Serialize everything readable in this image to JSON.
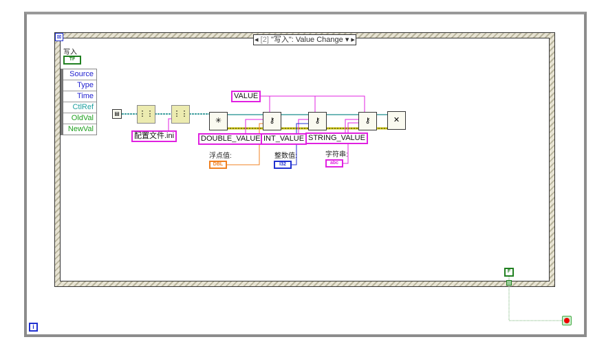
{
  "event_structure": {
    "case_index": "[2]",
    "case_label": "\"写入\": Value Change",
    "dropdown_icon": "triangle-down-icon"
  },
  "control": {
    "label": "写入",
    "terminal": "TF"
  },
  "event_data_node": {
    "items": [
      "Source",
      "Type",
      "Time",
      "CtlRef",
      "OldVal",
      "NewVal"
    ],
    "colors": [
      "#2020d0",
      "#2020d0",
      "#2020d0",
      "#20a0a0",
      "#20a020",
      "#20a020"
    ]
  },
  "constants": {
    "file": "配置文件.ini",
    "section": "VALUE",
    "keys": [
      "DOUBLE_VALUE",
      "INT_VALUE",
      "STRING_VALUE"
    ]
  },
  "indicators": [
    {
      "label": "浮点值:",
      "terminal": "DBL",
      "color": "#f08020"
    },
    {
      "label": "整数值:",
      "terminal": "I32",
      "color": "#2030d0"
    },
    {
      "label": "字符串:",
      "terminal": "abc",
      "color": "#e020e0"
    }
  ],
  "loop": {
    "stop_constant": "F",
    "iteration": "i"
  },
  "colors": {
    "refnum_wire": "#40a0a0",
    "error_wire": "#c8c000",
    "string_wire": "#e020e0",
    "bool": "#208020"
  }
}
